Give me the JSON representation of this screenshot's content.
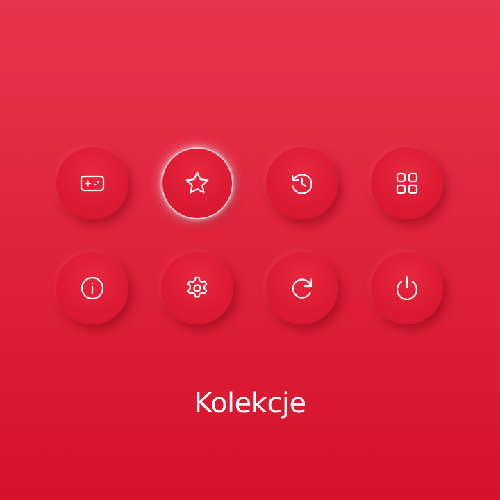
{
  "menu": {
    "items": [
      {
        "icon": "gamepad-icon",
        "selected": false
      },
      {
        "icon": "star-icon",
        "selected": true
      },
      {
        "icon": "history-icon",
        "selected": false
      },
      {
        "icon": "grid-icon",
        "selected": false
      },
      {
        "icon": "info-icon",
        "selected": false
      },
      {
        "icon": "gear-icon",
        "selected": false
      },
      {
        "icon": "refresh-icon",
        "selected": false
      },
      {
        "icon": "power-icon",
        "selected": false
      }
    ],
    "selected_label": "Kolekcje"
  },
  "colors": {
    "background_top": "#e8344c",
    "background_bottom": "#d6122c",
    "icon": "#ffffff"
  }
}
